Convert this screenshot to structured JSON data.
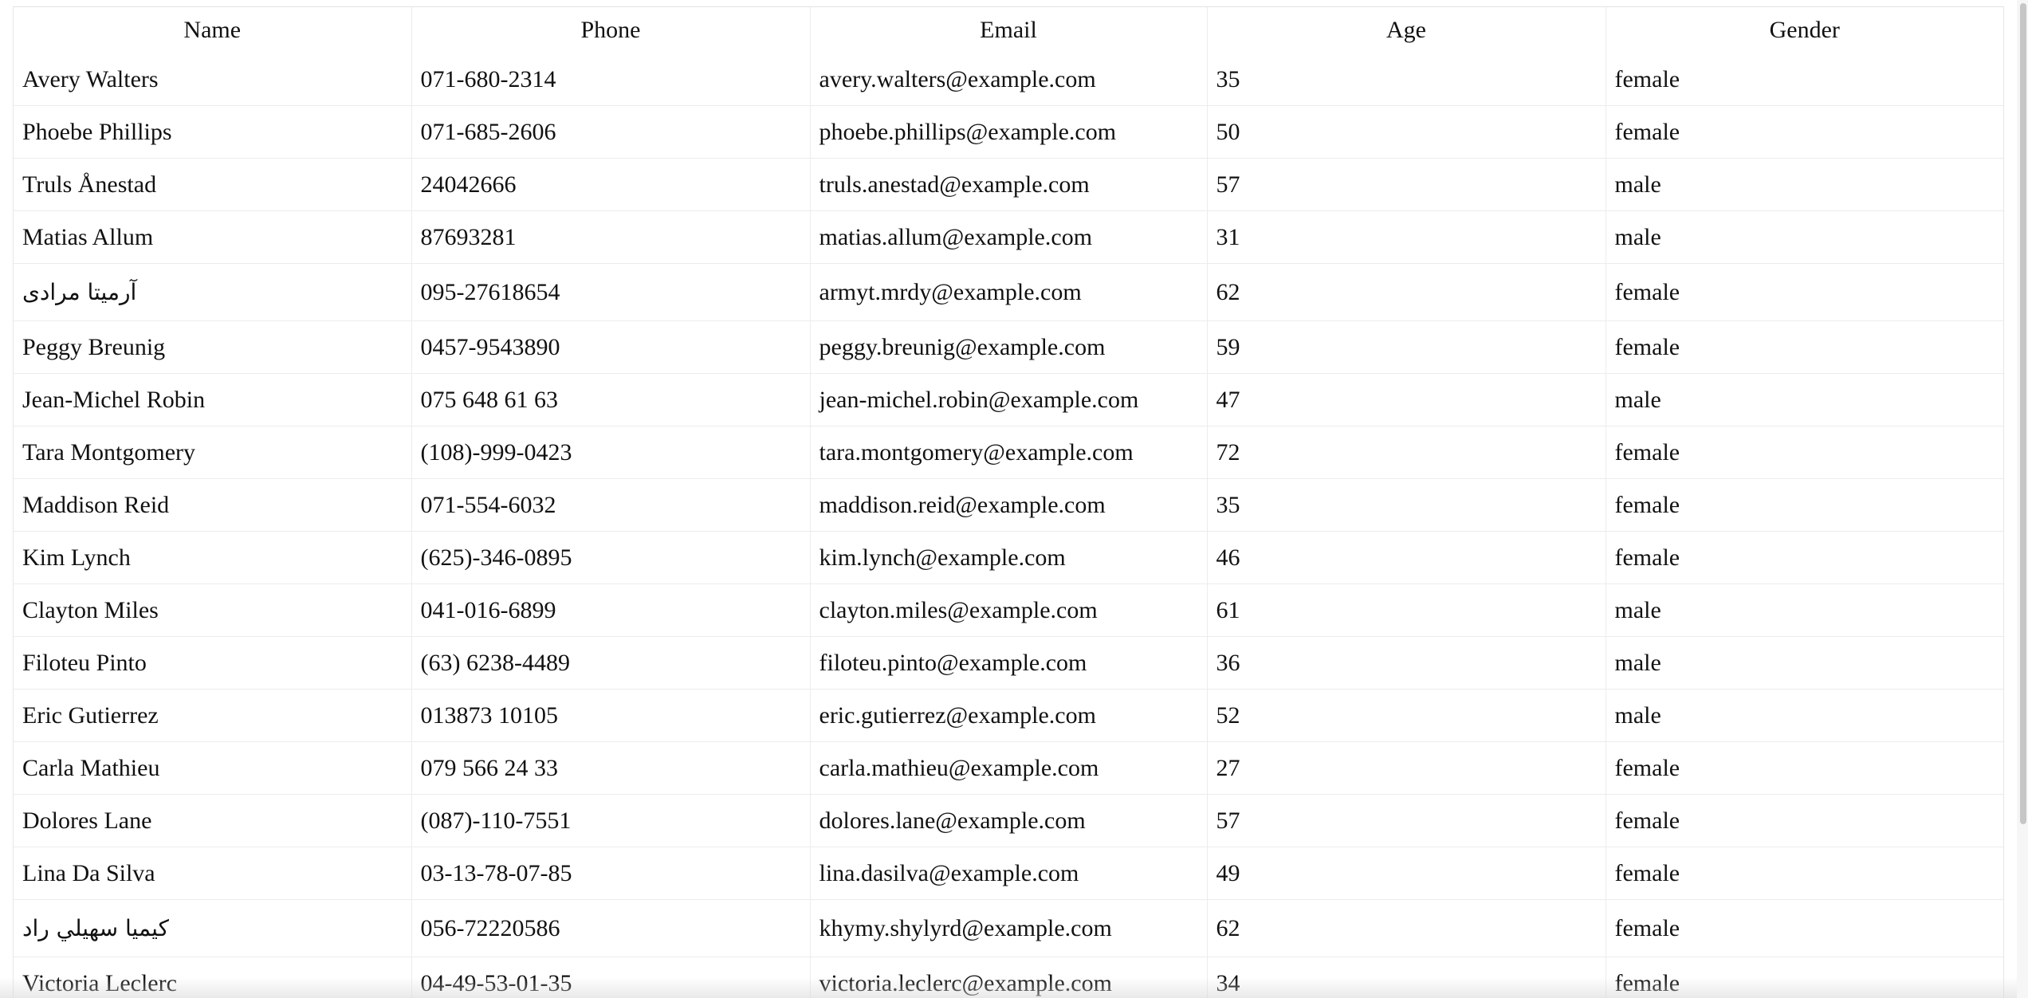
{
  "table": {
    "columns": [
      "Name",
      "Phone",
      "Email",
      "Age",
      "Gender"
    ],
    "rows": [
      [
        "Avery Walters",
        "071-680-2314",
        "avery.walters@example.com",
        "35",
        "female"
      ],
      [
        "Phoebe Phillips",
        "071-685-2606",
        "phoebe.phillips@example.com",
        "50",
        "female"
      ],
      [
        "Truls Ånestad",
        "24042666",
        "truls.anestad@example.com",
        "57",
        "male"
      ],
      [
        "Matias Allum",
        "87693281",
        "matias.allum@example.com",
        "31",
        "male"
      ],
      [
        "آرمیتا مرادی",
        "095-27618654",
        "armyt.mrdy@example.com",
        "62",
        "female"
      ],
      [
        "Peggy Breunig",
        "0457-9543890",
        "peggy.breunig@example.com",
        "59",
        "female"
      ],
      [
        "Jean-Michel Robin",
        "075 648 61 63",
        "jean-michel.robin@example.com",
        "47",
        "male"
      ],
      [
        "Tara Montgomery",
        "(108)-999-0423",
        "tara.montgomery@example.com",
        "72",
        "female"
      ],
      [
        "Maddison Reid",
        "071-554-6032",
        "maddison.reid@example.com",
        "35",
        "female"
      ],
      [
        "Kim Lynch",
        "(625)-346-0895",
        "kim.lynch@example.com",
        "46",
        "female"
      ],
      [
        "Clayton Miles",
        "041-016-6899",
        "clayton.miles@example.com",
        "61",
        "male"
      ],
      [
        "Filoteu Pinto",
        "(63) 6238-4489",
        "filoteu.pinto@example.com",
        "36",
        "male"
      ],
      [
        "Eric Gutierrez",
        "013873 10105",
        "eric.gutierrez@example.com",
        "52",
        "male"
      ],
      [
        "Carla Mathieu",
        "079 566 24 33",
        "carla.mathieu@example.com",
        "27",
        "female"
      ],
      [
        "Dolores Lane",
        "(087)-110-7551",
        "dolores.lane@example.com",
        "57",
        "female"
      ],
      [
        "Lina Da Silva",
        "03-13-78-07-85",
        "lina.dasilva@example.com",
        "49",
        "female"
      ],
      [
        "كيميا سهيلي راد",
        "056-72220586",
        "khymy.shylyrd@example.com",
        "62",
        "female"
      ],
      [
        "Victoria Leclerc",
        "04-49-53-01-35",
        "victoria.leclerc@example.com",
        "34",
        "female"
      ]
    ],
    "rtl_rows": [
      4,
      16
    ]
  }
}
